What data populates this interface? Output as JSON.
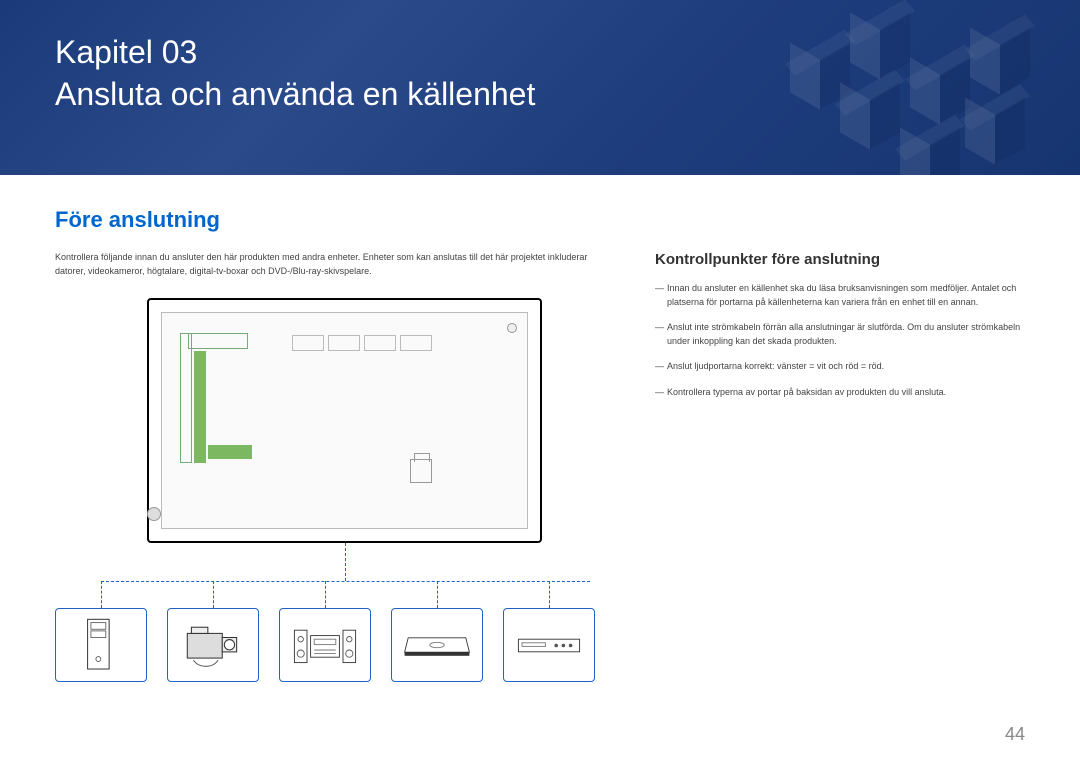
{
  "chapter_line": "Kapitel 03",
  "chapter_title": "Ansluta och använda en källenhet",
  "section_heading": "Före anslutning",
  "intro_paragraph": "Kontrollera följande innan du ansluter den här produkten med andra enheter. Enheter som kan anslutas till det här projektet inkluderar datorer, videokameror, högtalare, digital-tv-boxar och DVD-/Blu-ray-skivspelare.",
  "subheading": "Kontrollpunkter före anslutning",
  "checkpoints": [
    "Innan du ansluter en källenhet ska du läsa bruksanvisningen som medföljer. Antalet och platserna för portarna på källenheterna kan variera från en enhet till en annan.",
    "Anslut inte strömkabeln förrän alla anslutningar är slutförda. Om du ansluter strömkabeln under inkoppling kan det skada produkten.",
    "Anslut ljudportarna korrekt: vänster = vit och röd = röd.",
    "Kontrollera typerna av portar på baksidan av produkten du vill ansluta."
  ],
  "devices": [
    {
      "name": "pc-tower-icon"
    },
    {
      "name": "camcorder-icon"
    },
    {
      "name": "hifi-system-icon"
    },
    {
      "name": "settop-box-icon"
    },
    {
      "name": "disc-player-icon"
    }
  ],
  "page_number": "44"
}
